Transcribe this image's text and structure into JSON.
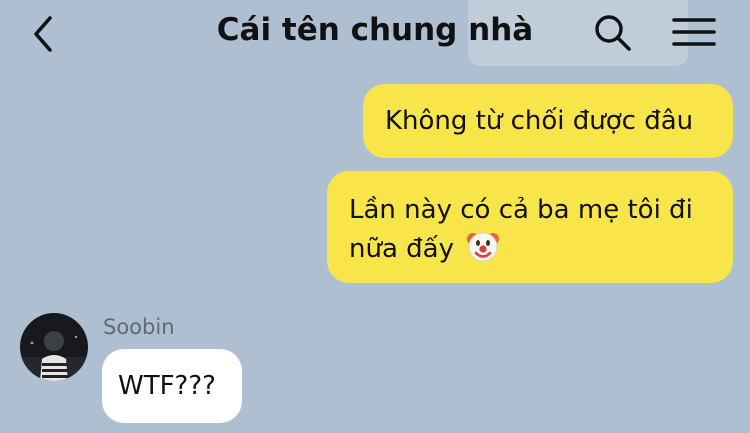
{
  "header": {
    "title": "Cái tên chung nhà",
    "back_icon": "chevron-left-icon",
    "search_icon": "search-icon",
    "menu_icon": "hamburger-menu-icon"
  },
  "messages": [
    {
      "direction": "outgoing",
      "text": "Không từ chối được đâu"
    },
    {
      "direction": "outgoing",
      "text": "Lần này có cả ba mẹ tôi đi nữa đấy",
      "emoji": "🤡"
    },
    {
      "direction": "incoming",
      "sender": "Soobin",
      "text": "WTF???"
    }
  ],
  "colors": {
    "background": "#aebfd1",
    "outgoing_bubble": "#f8e54a",
    "incoming_bubble": "#ffffff",
    "sender_name": "#5d6b79"
  }
}
